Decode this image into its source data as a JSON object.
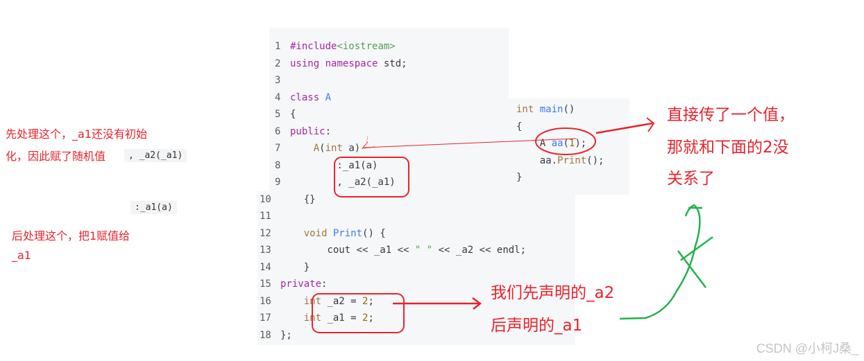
{
  "code_block": {
    "lines": [
      {
        "n": "1",
        "segs": [
          [
            "pp",
            "#include"
          ],
          [
            "inc",
            "<iostream>"
          ]
        ]
      },
      {
        "n": "2",
        "segs": [
          [
            "kw",
            "using"
          ],
          [
            "",
            " "
          ],
          [
            "kw",
            "namespace"
          ],
          [
            "",
            " std;"
          ]
        ]
      },
      {
        "n": "3",
        "segs": []
      },
      {
        "n": "4",
        "segs": [
          [
            "kw",
            "class"
          ],
          [
            "",
            " "
          ],
          [
            "fn",
            "A"
          ]
        ]
      },
      {
        "n": "5",
        "segs": [
          [
            "",
            "{"
          ]
        ]
      },
      {
        "n": "6",
        "segs": [
          [
            "kw",
            "public"
          ],
          [
            "",
            ":"
          ]
        ]
      },
      {
        "n": "7",
        "segs": [
          [
            "",
            "    "
          ],
          [
            "ty",
            "A"
          ],
          [
            "",
            "("
          ],
          [
            "ty",
            "int"
          ],
          [
            "",
            " a)"
          ]
        ]
      },
      {
        "n": "8",
        "segs": [
          [
            "",
            "        :_a1(a)"
          ]
        ]
      },
      {
        "n": "9",
        "segs": [
          [
            "",
            "        , _a2(_a1)"
          ]
        ]
      },
      {
        "n": "10",
        "segs": [
          [
            "",
            "    {}"
          ]
        ]
      },
      {
        "n": "11",
        "segs": []
      },
      {
        "n": "12",
        "segs": [
          [
            "",
            "    "
          ],
          [
            "ty",
            "void"
          ],
          [
            "",
            " "
          ],
          [
            "fn",
            "Print"
          ],
          [
            "",
            "() {"
          ]
        ]
      },
      {
        "n": "13",
        "segs": [
          [
            "",
            "        cout << _a1 << "
          ],
          [
            "st",
            "\" \""
          ],
          [
            "",
            " << _a2 << endl;"
          ]
        ]
      },
      {
        "n": "14",
        "segs": [
          [
            "",
            "    }"
          ]
        ]
      },
      {
        "n": "15",
        "segs": [
          [
            "kw",
            "private"
          ],
          [
            "",
            ":"
          ]
        ]
      },
      {
        "n": "16",
        "segs": [
          [
            "",
            "    "
          ],
          [
            "ty",
            "int"
          ],
          [
            "",
            " _a2 = "
          ],
          [
            "nm",
            "2"
          ],
          [
            "",
            ";"
          ]
        ]
      },
      {
        "n": "17",
        "segs": [
          [
            "",
            "    "
          ],
          [
            "ty",
            "int"
          ],
          [
            "",
            " _a1 = "
          ],
          [
            "nm",
            "2"
          ],
          [
            "",
            ";"
          ]
        ]
      },
      {
        "n": "18",
        "segs": [
          [
            "",
            "};"
          ]
        ]
      }
    ]
  },
  "main_block": {
    "lines": [
      {
        "segs": [
          [
            "ty",
            "int"
          ],
          [
            "",
            " "
          ],
          [
            "fn",
            "main"
          ],
          [
            "",
            "()"
          ]
        ]
      },
      {
        "segs": [
          [
            "",
            "{"
          ]
        ]
      },
      {
        "segs": [
          [
            "",
            "    A "
          ],
          [
            "fn",
            "aa"
          ],
          [
            "",
            "("
          ],
          [
            "nm",
            "1"
          ],
          [
            "",
            ");"
          ]
        ]
      },
      {
        "segs": [
          [
            "",
            "    aa."
          ],
          [
            "ty",
            "Print"
          ],
          [
            "",
            "();"
          ]
        ]
      },
      {
        "segs": [
          [
            "",
            "}"
          ]
        ]
      }
    ]
  },
  "annotations": {
    "left_note_line1": "先处理这个，_a1还没有初始",
    "left_note_line2": "化，因此赋了随机值",
    "snippet_a2": ", _a2(_a1)",
    "snippet_a1": ":_a1(a)",
    "left_note2_line1": "后处理这个，把1赋值给",
    "left_note2_line2": "_a1",
    "right_note_line1": "直接传了一个值，",
    "right_note_line2": "那就和下面的2没",
    "right_note_line3": "关系了",
    "bottom_note_line1": "我们先声明的_a2",
    "bottom_note_line2": "后声明的_a1"
  },
  "colors": {
    "annotation_red": "#e8232c",
    "annotation_green": "#22b14c"
  },
  "watermark": "CSDN @小柯J桑_"
}
